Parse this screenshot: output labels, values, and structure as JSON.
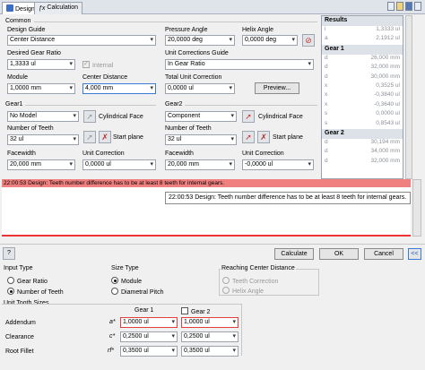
{
  "tabs": [
    {
      "label": "Design"
    },
    {
      "label": "Calculation"
    }
  ],
  "common": {
    "title": "Common",
    "design_guide_label": "Design Guide",
    "design_guide_value": "Center Distance",
    "desired_ratio_label": "Desired Gear Ratio",
    "desired_ratio_value": "1,3333 ul",
    "internal_label": "Internal",
    "module_label": "Module",
    "module_value": "1,0000 mm",
    "center_distance_label": "Center Distance",
    "center_distance_value": "4,000 mm",
    "pressure_angle_label": "Pressure Angle",
    "pressure_angle_value": "20,0000 deg",
    "helix_angle_label": "Helix Angle",
    "helix_angle_value": "0,0000 deg",
    "unit_corr_guide_label": "Unit Corrections Guide",
    "unit_corr_guide_value": "In Gear Ratio",
    "total_unit_corr_label": "Total Unit Correction",
    "total_unit_corr_value": "0,0000 ul",
    "preview_label": "Preview..."
  },
  "gear1": {
    "title": "Gear1",
    "type_value": "No Model",
    "cyl_face_label": "Cylindrical Face",
    "teeth_label": "Number of Teeth",
    "teeth_value": "32 ul",
    "start_plane_label": "Start plane",
    "facewidth_label": "Facewidth",
    "facewidth_value": "20,000 mm",
    "unit_corr_label": "Unit Correction",
    "unit_corr_value": "0,0000 ul"
  },
  "gear2": {
    "title": "Gear2",
    "type_value": "Component",
    "cyl_face_label": "Cylindrical Face",
    "teeth_label": "Number of Teeth",
    "teeth_value": "32 ul",
    "start_plane_label": "Start plane",
    "facewidth_label": "Facewidth",
    "facewidth_value": "20,000 mm",
    "unit_corr_label": "Unit Correction",
    "unit_corr_value": "-0,0000 ul"
  },
  "results": {
    "title": "Results",
    "top_rows": [
      {
        "sym": "i",
        "val": "1,3333 ul"
      },
      {
        "sym": "a",
        "val": "2,1912 ul"
      }
    ],
    "gear1_title": "Gear 1",
    "gear1_rows": [
      {
        "sym": "d",
        "val": "26,000 mm"
      },
      {
        "sym": "d",
        "val": "32,000 mm"
      },
      {
        "sym": "d",
        "val": "30,000 mm"
      },
      {
        "sym": "x",
        "val": "0,3525 ul"
      },
      {
        "sym": "x",
        "val": "-0,3840 ul"
      },
      {
        "sym": "x",
        "val": "-0,3640 ul"
      },
      {
        "sym": "s",
        "val": "0,0000 ul"
      },
      {
        "sym": "s",
        "val": "0,8543 ul"
      }
    ],
    "gear2_title": "Gear 2",
    "gear2_rows": [
      {
        "sym": "d",
        "val": "30,194 mm"
      },
      {
        "sym": "d",
        "val": "34,000 mm"
      },
      {
        "sym": "d",
        "val": "32,000 mm"
      }
    ]
  },
  "error_message": "22:00:53 Design: Teeth number difference has to be at least 8 teeth for internal gears.",
  "tooltip_message": "22:00:53 Design: Teeth number difference has to be at least 8 teeth for internal gears.",
  "buttons": {
    "calculate": "Calculate",
    "ok": "OK",
    "cancel": "Cancel",
    "collapse": "<<"
  },
  "lower": {
    "input_type_title": "Input Type",
    "input_gear_ratio": "Gear Ratio",
    "input_number_teeth": "Number of Teeth",
    "size_type_title": "Size Type",
    "size_module": "Module",
    "size_diametral_pitch": "Diametral Pitch",
    "reaching_title": "Reaching Center Distance",
    "reaching_teeth_corr": "Teeth Correction",
    "reaching_helix": "Helix Angle",
    "unit_tooth_title": "Unit Tooth Sizes",
    "col_gear1": "Gear 1",
    "col_gear2": "Gear 2",
    "rows": [
      {
        "label": "Addendum",
        "sym": "a*",
        "g1": "1,0000 ul",
        "g2": "1,0000 ul"
      },
      {
        "label": "Clearance",
        "sym": "c*",
        "g1": "0,2500 ul",
        "g2": "0,2500 ul"
      },
      {
        "label": "Root Fillet",
        "sym": "rf*",
        "g1": "0,3500 ul",
        "g2": "0,3500 ul"
      }
    ]
  }
}
